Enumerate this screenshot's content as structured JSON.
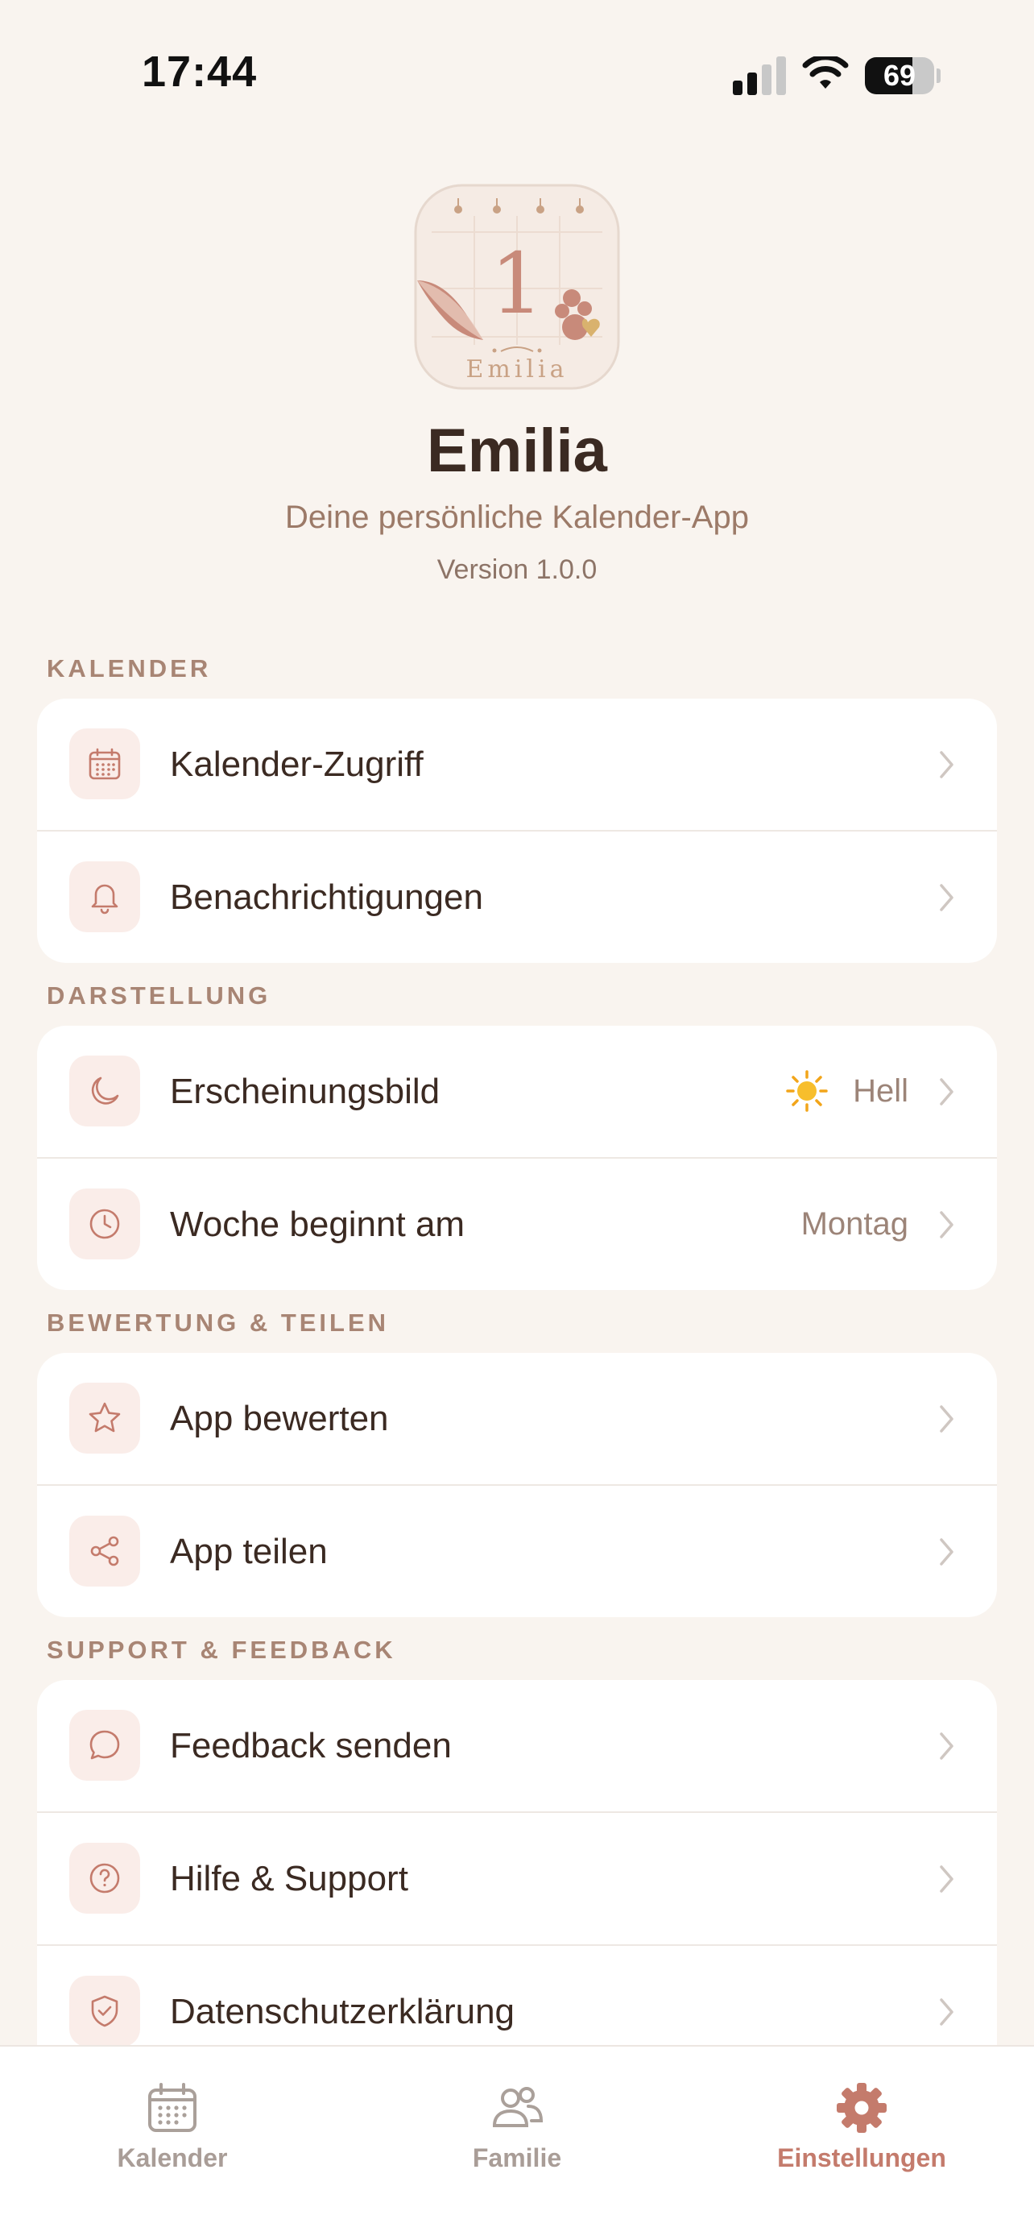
{
  "status_bar": {
    "time": "17:44",
    "battery": "69",
    "battery_level": 0.69
  },
  "header": {
    "logo_number": "1",
    "logo_text": "Emilia",
    "app_name": "Emilia",
    "subtitle": "Deine persönliche Kalender-App",
    "version": "Version 1.0.0"
  },
  "sections": [
    {
      "title": "KALENDER",
      "items": [
        {
          "label": "Kalender-Zugriff",
          "icon": "calendar-icon"
        },
        {
          "label": "Benachrichtigungen",
          "icon": "bell-icon"
        }
      ]
    },
    {
      "title": "DARSTELLUNG",
      "items": [
        {
          "label": "Erscheinungsbild",
          "icon": "moon-icon",
          "value": "Hell",
          "value_icon": "sun-icon"
        },
        {
          "label": "Woche beginnt am",
          "icon": "clock-icon",
          "value": "Montag"
        }
      ]
    },
    {
      "title": "BEWERTUNG & TEILEN",
      "items": [
        {
          "label": "App bewerten",
          "icon": "star-icon"
        },
        {
          "label": "App teilen",
          "icon": "share-icon"
        }
      ]
    },
    {
      "title": "SUPPORT & FEEDBACK",
      "items": [
        {
          "label": "Feedback senden",
          "icon": "chat-bubble-icon"
        },
        {
          "label": "Hilfe & Support",
          "icon": "question-icon"
        },
        {
          "label": "Datenschutzerklärung",
          "icon": "shield-check-icon"
        }
      ]
    }
  ],
  "tab_bar": {
    "tabs": [
      {
        "label": "Kalender",
        "icon": "calendar-icon",
        "active": false
      },
      {
        "label": "Familie",
        "icon": "people-icon",
        "active": false
      },
      {
        "label": "Einstellungen",
        "icon": "gear-icon",
        "active": true
      }
    ]
  },
  "colors": {
    "background": "#f9f4ef",
    "accent": "#c47b6c",
    "text": "#3b2a22",
    "icon_tile": "#faede9"
  }
}
